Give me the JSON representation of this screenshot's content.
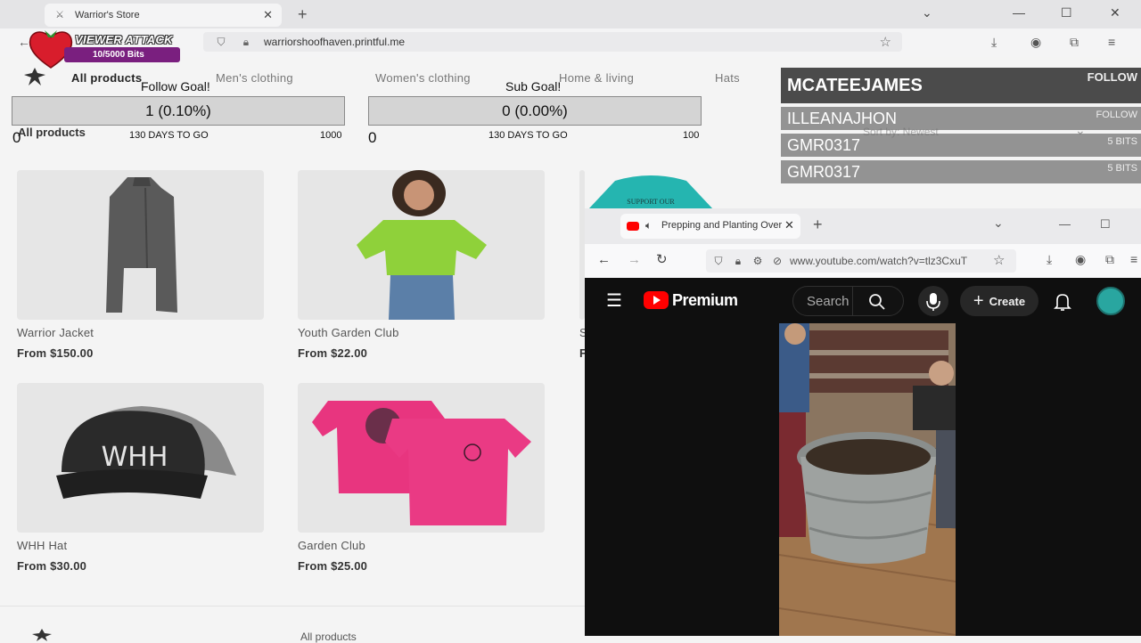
{
  "browser": {
    "tab_title": "Warrior's Store",
    "url_host": "warriorshoofhaven.printful.me"
  },
  "store": {
    "nav": [
      "All products",
      "Men's clothing",
      "Women's clothing",
      "Home & living",
      "Hats"
    ],
    "section_title": "All products",
    "sort_label": "Sort by: Newest",
    "products": [
      {
        "name": "Warrior Jacket",
        "price": "From $150.00"
      },
      {
        "name": "Youth Garden Club",
        "price": "From $22.00"
      },
      {
        "name": "WHH Hat",
        "price": "From $30.00"
      },
      {
        "name": "Garden Club",
        "price": "From $25.00"
      }
    ],
    "partial_name": "S",
    "partial_price": "F",
    "shirt_text": "SUPPORT OUR",
    "hat_text": "WHH",
    "footer_link": "All products"
  },
  "overlay": {
    "viewer_attack": {
      "label": "VIEWER ATTACK",
      "progress": "10/5000 Bits"
    },
    "follow_goal": {
      "title": "Follow Goal!",
      "value": "1 (0.10%)",
      "start": "0",
      "days": "130 DAYS TO GO",
      "target": "1000"
    },
    "sub_goal": {
      "title": "Sub Goal!",
      "value": "0 (0.00%)",
      "start": "0",
      "days": "130 DAYS TO GO",
      "target": "100"
    },
    "events": [
      {
        "name": "MCATEEJAMES",
        "tag": "FOLLOW"
      },
      {
        "name": "ILLEANAJHON",
        "tag": "FOLLOW"
      },
      {
        "name": "GMR0317",
        "tag": "5 BITS"
      },
      {
        "name": "GMR0317",
        "tag": "5 BITS"
      }
    ]
  },
  "youtube": {
    "tab_title": "Prepping and Planting Over",
    "url": "www.youtube.com/watch?v=tlz3CxuT",
    "brand": "Premium",
    "search_placeholder": "Search",
    "create_label": "Create"
  },
  "colors": {
    "youtube_red": "#ff0000",
    "overlay_purple": "#7a1f7f",
    "lime_shirt": "#8fd13a",
    "pink_shirt": "#e8357f",
    "teal_shirt": "#25b5b0"
  }
}
